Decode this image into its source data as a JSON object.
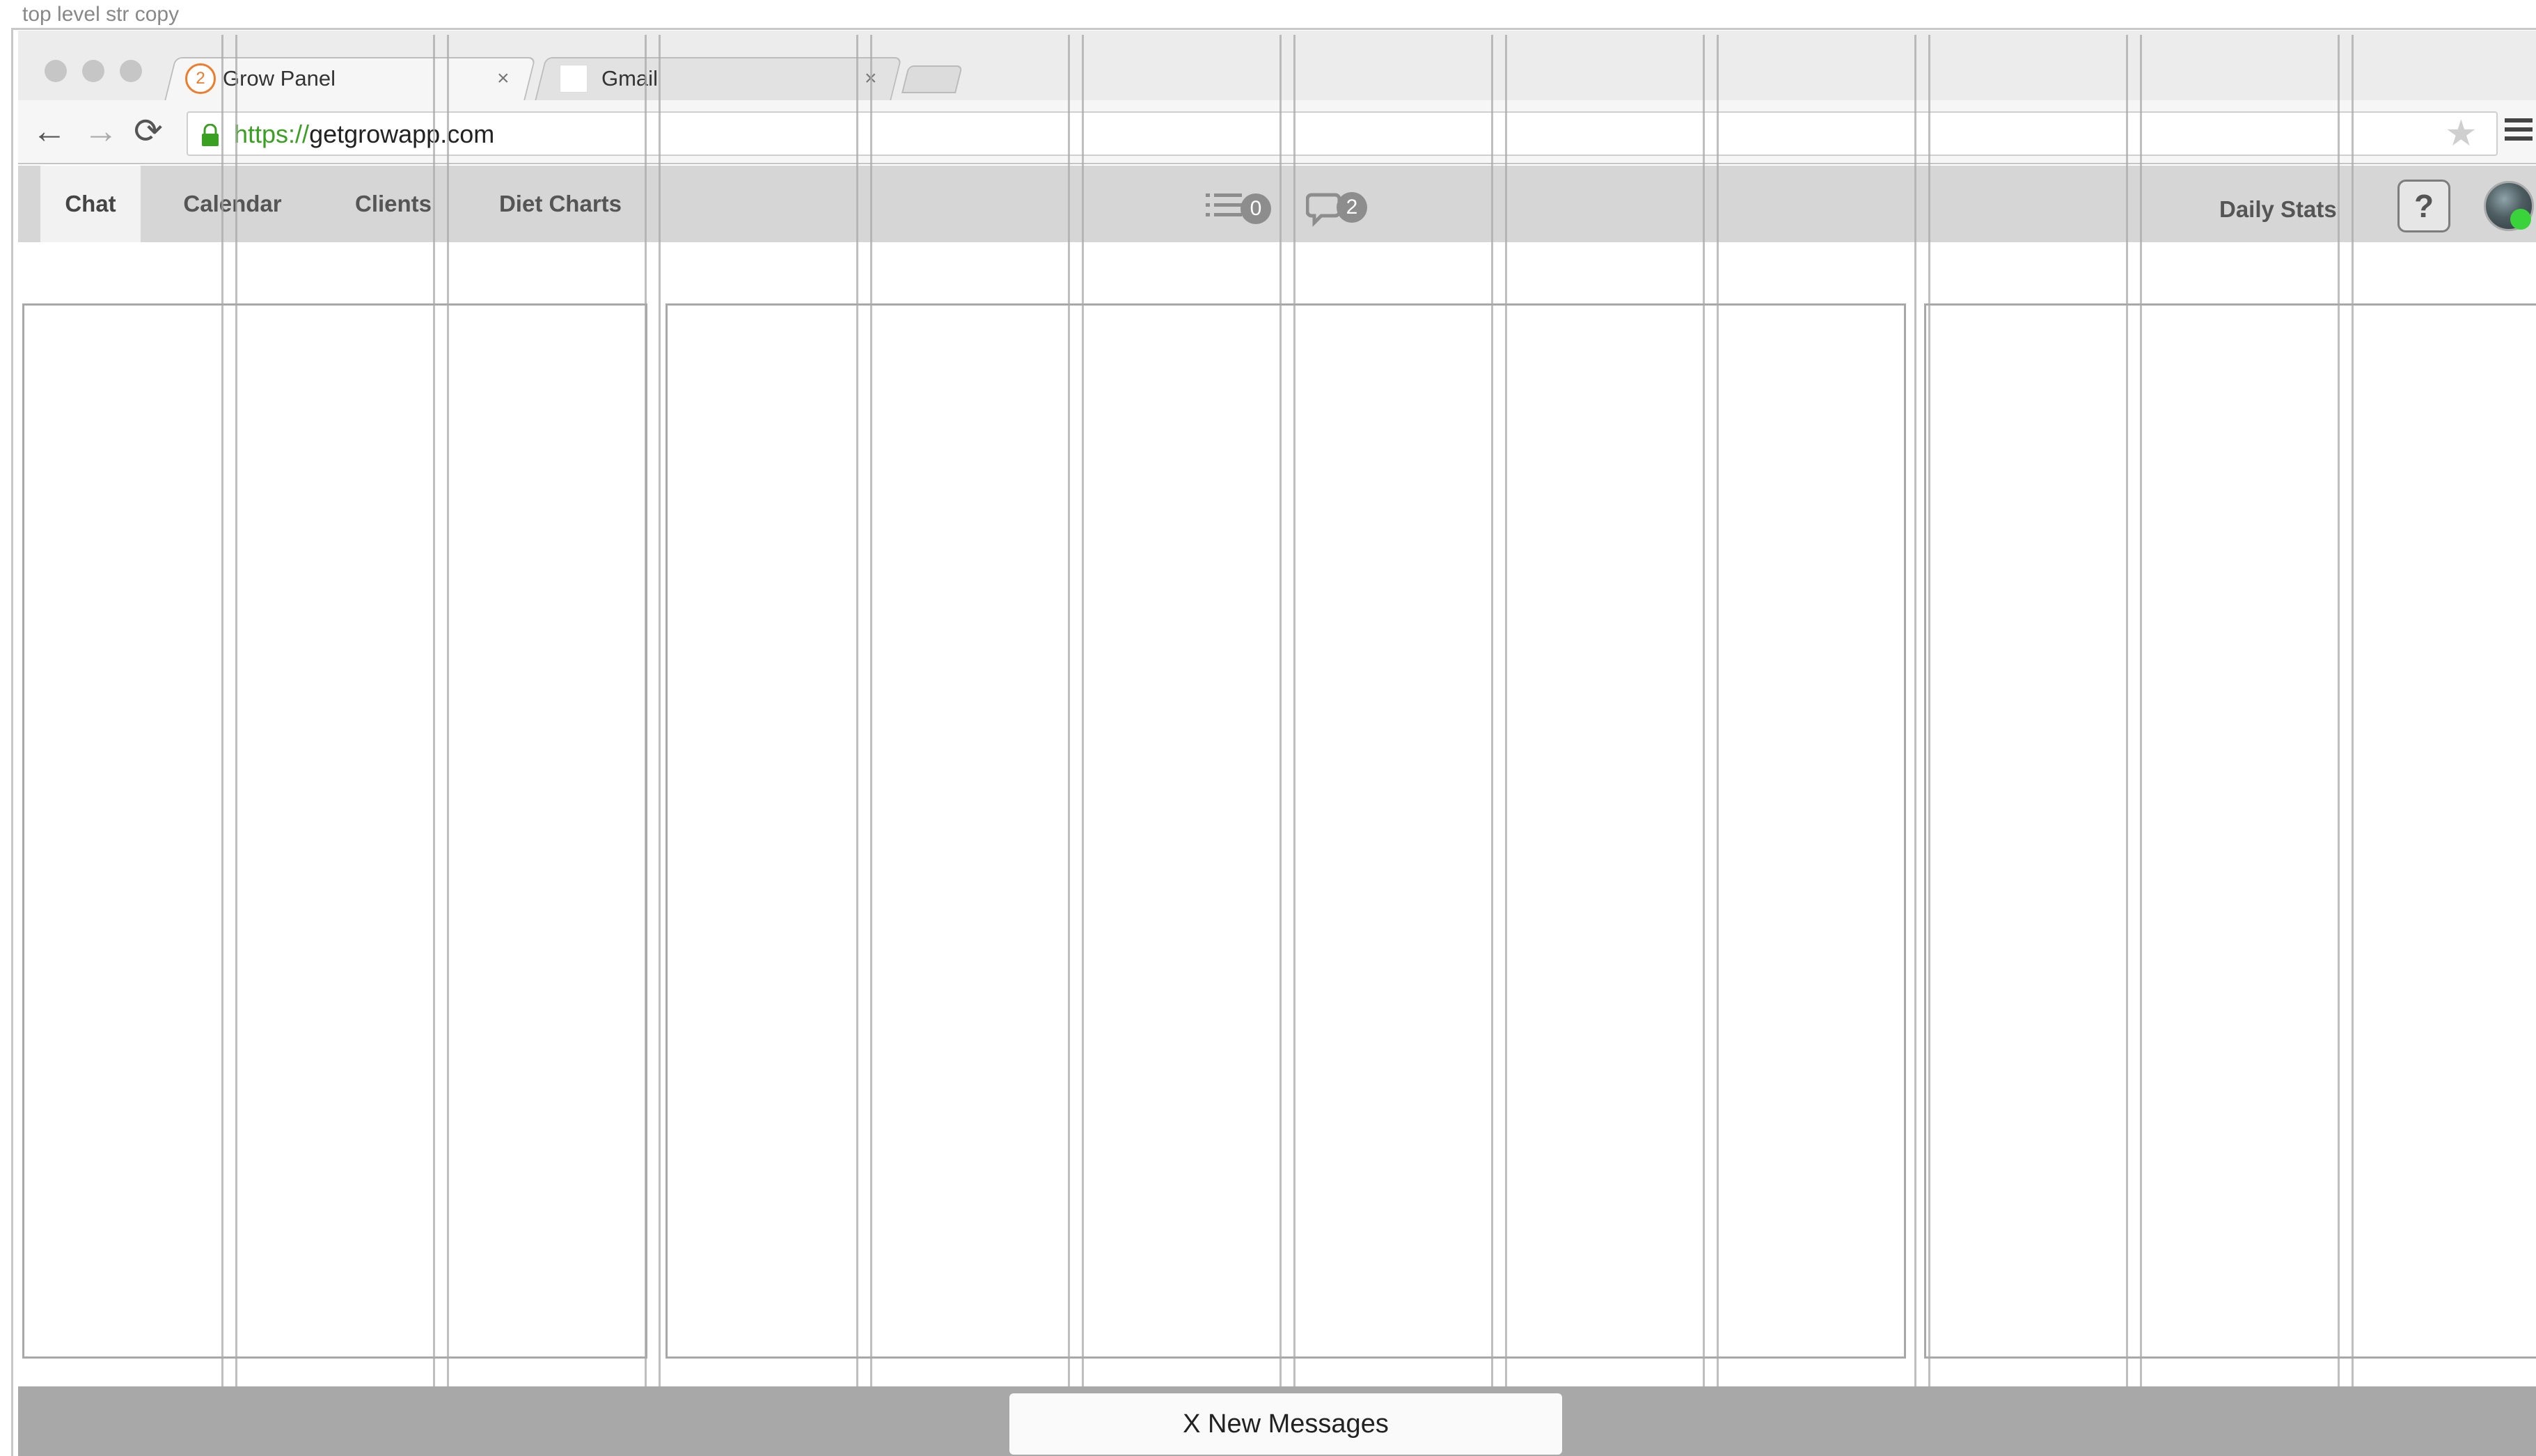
{
  "frame": {
    "label": "top level str copy"
  },
  "browser": {
    "tabs": [
      {
        "badge": "2",
        "title": "Grow Panel",
        "close": "×"
      },
      {
        "title": "Gmail",
        "close": "×"
      }
    ],
    "url": {
      "scheme": "https://",
      "host": "getgrowapp.com"
    },
    "icons": {
      "back": "←",
      "forward": "→",
      "reload": "⟳",
      "bookmark": "★"
    }
  },
  "app": {
    "nav_tabs": [
      "Chat",
      "Calendar",
      "Clients",
      "Diet Charts"
    ],
    "active_tab": "Chat",
    "todo_count": "0",
    "chat_count": "2",
    "daily_stats_label": "Daily Stats",
    "help_label": "?",
    "presence_color": "#3bd33b"
  },
  "footer": {
    "new_messages_label": "X New Messages"
  },
  "colors": {
    "badge_orange": "#f07b2a",
    "url_scheme_green": "#3aa021",
    "nav_bar": "#d6d6d6",
    "footer_bar": "#a8a8a8"
  }
}
